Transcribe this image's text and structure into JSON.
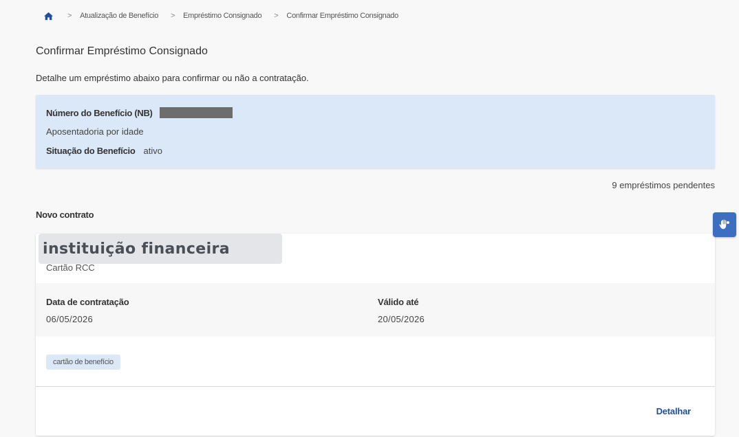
{
  "breadcrumb": {
    "items": [
      "Atualização de Benefício",
      "Empréstimo Consignado",
      "Confirmar Empréstimo Consignado"
    ]
  },
  "page": {
    "title": "Confirmar Empréstimo Consignado",
    "subtitle": "Detalhe um empréstimo abaixo para confirmar ou não a contratação."
  },
  "benefit": {
    "nb_label": "Número do Benefício (NB)",
    "type": "Aposentadoria por idade",
    "status_label": "Situação do Benefício",
    "status_value": "ativo"
  },
  "pending_text": "9 empréstimos pendentes",
  "new_contract": {
    "section_title": "Novo contrato",
    "institution": "instituição financeira",
    "product": "Cartão RCC",
    "contract_date_label": "Data de contratação",
    "contract_date": "06/05/2026",
    "valid_until_label": "Válido até",
    "valid_until": "20/05/2026",
    "tag": "cartão de benefício",
    "detail_label": "Detalhar"
  },
  "colors": {
    "accent": "#1f4f9b",
    "benefit_bg": "#dbe8f7",
    "vlibras": "#3d6fc1"
  },
  "icons": {
    "home": "home-icon",
    "accessibility": "vlibras-hands-icon"
  }
}
